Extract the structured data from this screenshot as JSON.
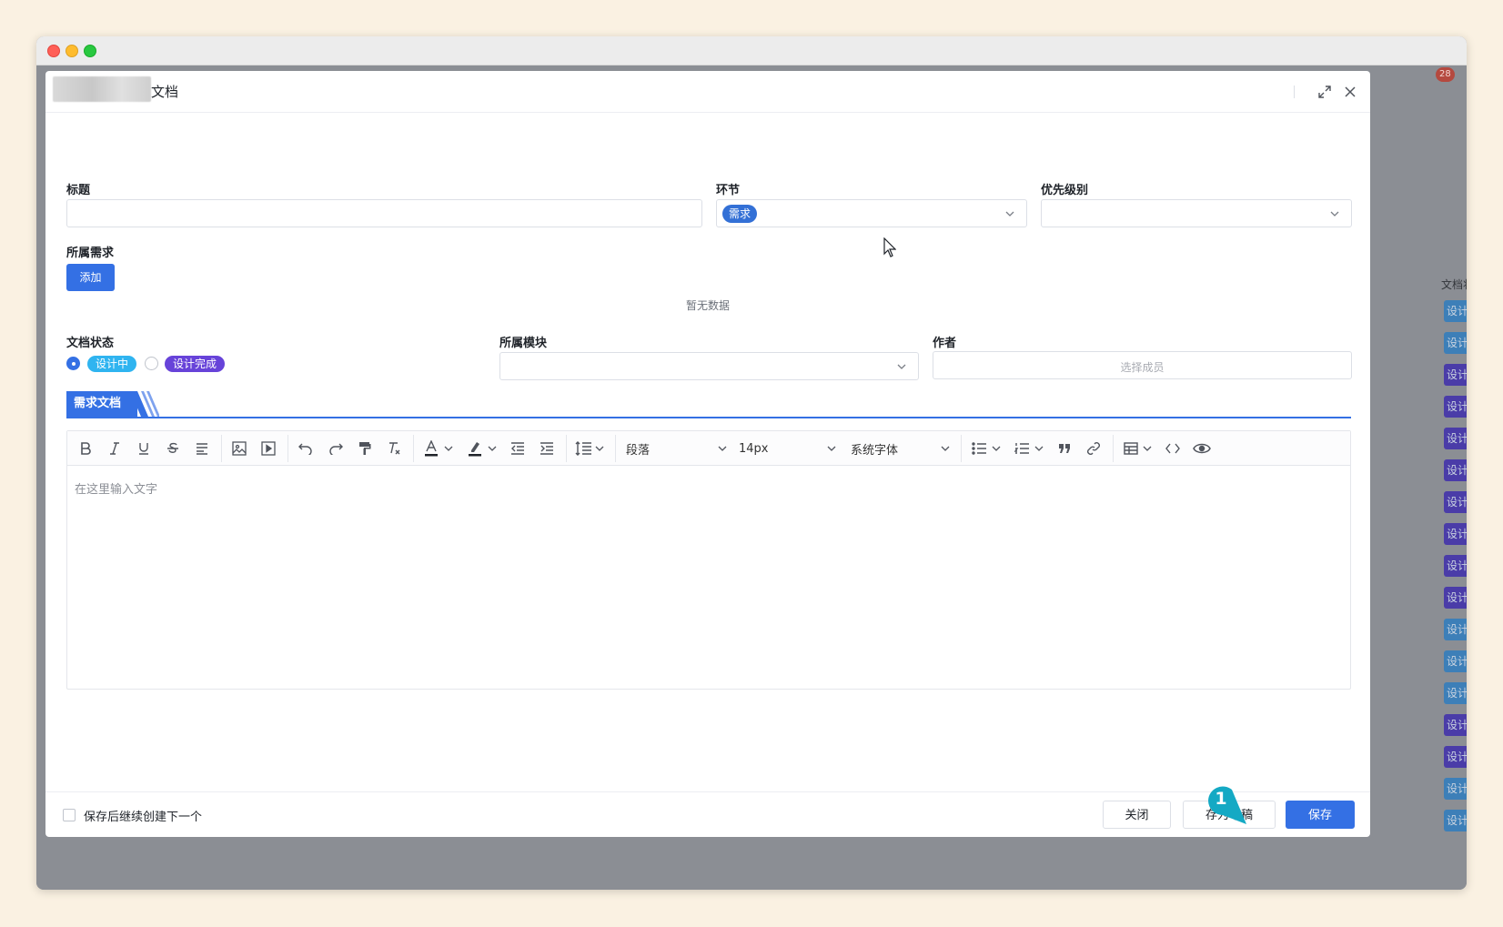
{
  "background": {
    "badge": "28",
    "column_header": "文档状",
    "tags": [
      "设计",
      "设计",
      "设计",
      "设计",
      "设计",
      "设计",
      "设计",
      "设计",
      "设计",
      "设计",
      "设计",
      "设计",
      "设计",
      "设计",
      "设计",
      "设计",
      "设计"
    ],
    "tag_colors": [
      "#3d7fb8",
      "#3d7fb8",
      "#4a3ca8",
      "#4a3ca8",
      "#4a3ca8",
      "#4a3ca8",
      "#4a3ca8",
      "#4a3ca8",
      "#4a3ca8",
      "#4a3ca8",
      "#3d7fb8",
      "#3d7fb8",
      "#3d7fb8",
      "#4a3ca8",
      "#4a3ca8",
      "#3d7fb8",
      "#3d7fb8"
    ]
  },
  "modal": {
    "title": "文档",
    "fields": {
      "title_label": "标题",
      "title_value": "",
      "stage_label": "环节",
      "stage_value": "需求",
      "priority_label": "优先级别",
      "priority_value": "",
      "requirement_label": "所属需求",
      "add_button": "添加",
      "empty_text": "暂无数据",
      "status_label": "文档状态",
      "status_options": [
        {
          "label": "设计中",
          "checked": true,
          "color": "#2fb4f0"
        },
        {
          "label": "设计完成",
          "checked": false,
          "color": "#6743d9"
        }
      ],
      "module_label": "所属模块",
      "module_value": "",
      "author_label": "作者",
      "author_placeholder": "选择成员"
    },
    "section_tab": "需求文档",
    "editor": {
      "paragraph": "段落",
      "font_size": "14px",
      "font_family": "系统字体",
      "placeholder": "在这里输入文字",
      "tools": [
        "bold-icon",
        "italic-icon",
        "underline-icon",
        "strikethrough-icon",
        "align-icon",
        "image-icon",
        "video-icon",
        "undo-icon",
        "redo-icon",
        "format-painter-icon",
        "clear-format-icon",
        "font-color-icon",
        "highlight-icon",
        "outdent-icon",
        "indent-icon",
        "line-height-icon",
        "bullet-list-icon",
        "numbered-list-icon",
        "quote-icon",
        "link-icon",
        "table-icon",
        "code-icon",
        "preview-icon"
      ]
    },
    "footer": {
      "continue_label": "保存后继续创建下一个",
      "continue_checked": false,
      "close_button": "关闭",
      "draft_button": "存为草稿",
      "save_button": "保存"
    }
  },
  "annotation": {
    "number": "1",
    "color": "#14a9c4"
  },
  "colors": {
    "primary": "#3470e4"
  }
}
